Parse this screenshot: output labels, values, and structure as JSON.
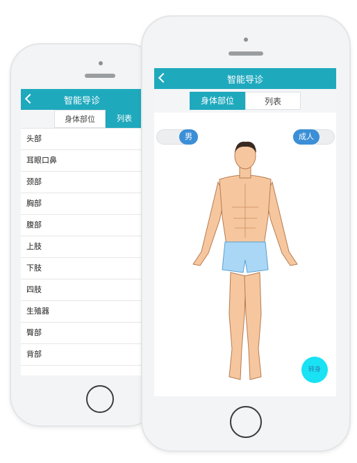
{
  "back_phone": {
    "nav_title": "智能导诊",
    "tabs": [
      "身体部位",
      "列表"
    ],
    "active_tab": "列表",
    "list_items": [
      "头部",
      "耳眼口鼻",
      "颈部",
      "胸部",
      "腹部",
      "上肢",
      "下肢",
      "四肢",
      "生殖器",
      "臀部",
      "背部"
    ]
  },
  "front_phone": {
    "nav_title": "智能导诊",
    "tabs": [
      "身体部位",
      "列表"
    ],
    "active_tab": "身体部位",
    "gender_toggle": "男",
    "age_toggle": "成人",
    "turn_button": "转身"
  },
  "colors": {
    "accent": "#1fa9bd",
    "toggle_blue": "#3b8fd6",
    "turn_cyan": "#18e2f3"
  }
}
